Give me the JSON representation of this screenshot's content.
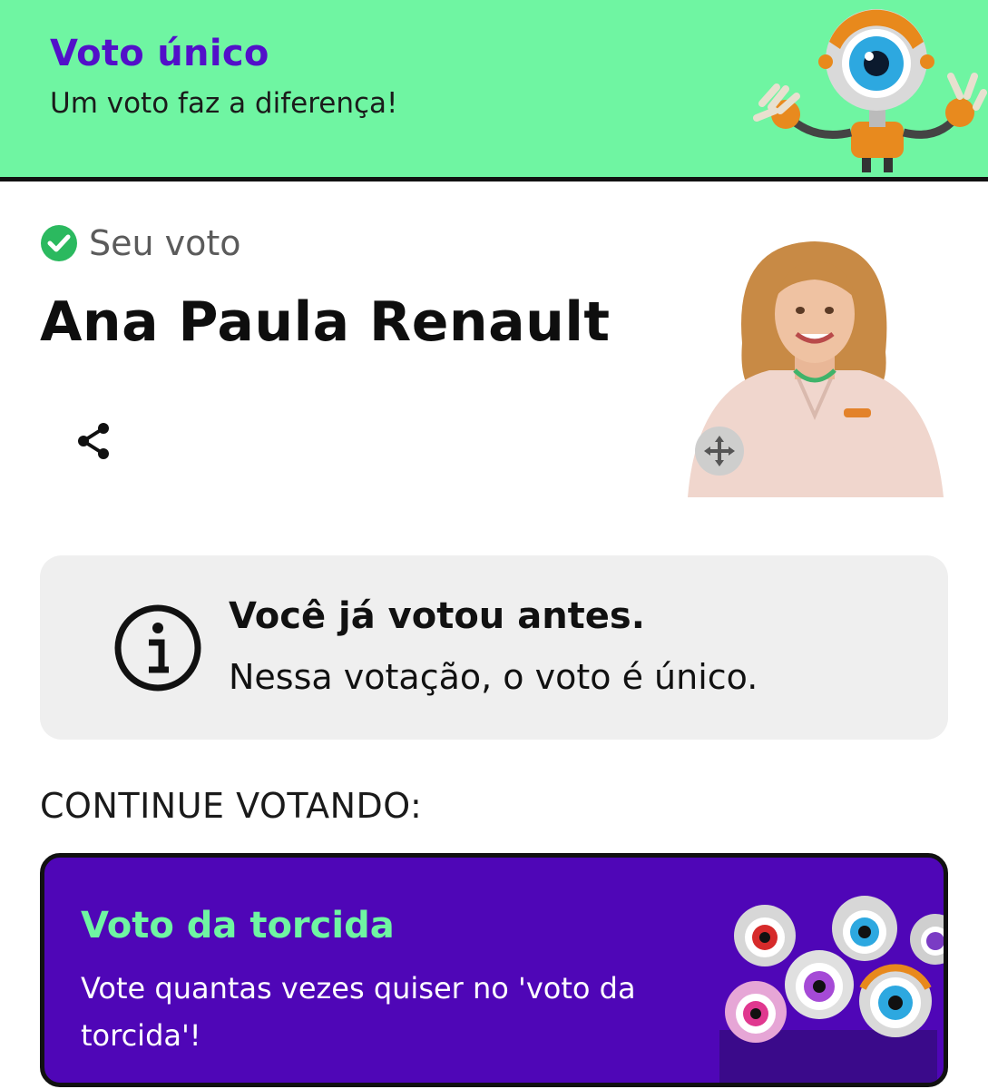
{
  "header": {
    "title": "Voto único",
    "subtitle": "Um voto faz a diferença!",
    "mascot_icon": "big-brother-eye-mascot"
  },
  "vote": {
    "status_icon": "check-circle-icon",
    "status_label": "Seu voto",
    "candidate_name": "Ana Paula Renault",
    "share_icon": "share-icon",
    "photo_icon": "candidate-photo",
    "move_icon": "move-arrows-icon"
  },
  "notice": {
    "icon": "info-icon",
    "title": "Você já votou antes.",
    "text": "Nessa votação, o voto é único."
  },
  "continue_label": "CONTINUE VOTANDO:",
  "fan_vote_card": {
    "title": "Voto da torcida",
    "text": "Vote quantas vezes quiser no 'voto da torcida'!",
    "image_icon": "eye-mascots-crowd"
  },
  "colors": {
    "header_bg": "#6ff5a2",
    "header_title": "#5210c9",
    "card_bg": "#4f06b7",
    "card_title": "#6ff5a2",
    "check_green": "#2bb95f",
    "notice_bg": "#efefef"
  }
}
